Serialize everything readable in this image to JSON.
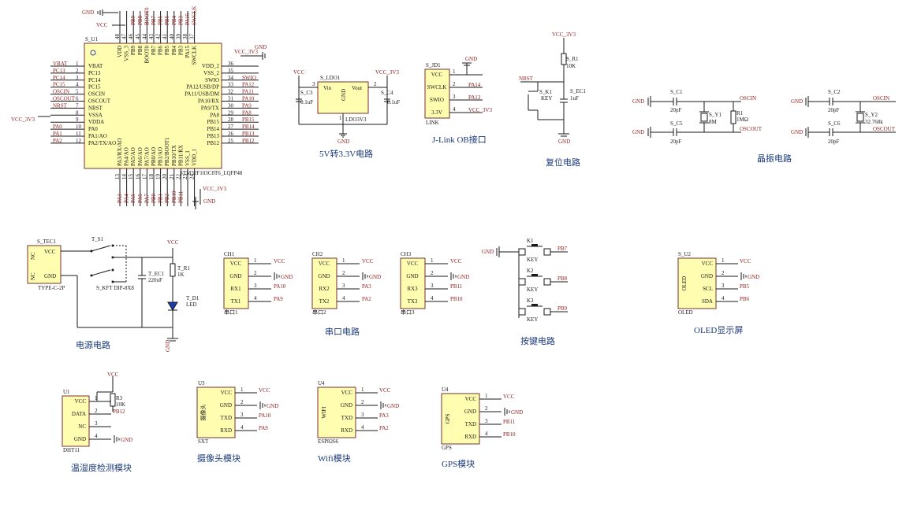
{
  "colors": {
    "part_fill": "#fffdb0",
    "part_border": "#7a3030",
    "wire": "#1a1a1a",
    "net": "#8b1a1a",
    "title": "#1a3a7a"
  },
  "mcu": {
    "ref": "S_U1",
    "part": "STM32F103C8T6_LQFP48",
    "left_pins": [
      {
        "n": "1",
        "name": "VBAT",
        "net": "VBAT"
      },
      {
        "n": "2",
        "name": "PC13",
        "net": "PC13"
      },
      {
        "n": "3",
        "name": "PC14",
        "net": "PC14"
      },
      {
        "n": "4",
        "name": "PC15",
        "net": "PC15"
      },
      {
        "n": "5",
        "name": "OSCIN",
        "net": "OSCIN"
      },
      {
        "n": "6",
        "name": "OSCOUT",
        "net": "OSCOUT"
      },
      {
        "n": "7",
        "name": "NRST",
        "net": "NRST"
      },
      {
        "n": "8",
        "name": "VSSA",
        "net": ""
      },
      {
        "n": "9",
        "name": "VDDA",
        "net": ""
      },
      {
        "n": "10",
        "name": "PA0",
        "net": "PA0"
      },
      {
        "n": "11",
        "name": "PA1/AO",
        "net": "PA1"
      },
      {
        "n": "12",
        "name": "PA2/TX/AO",
        "net": "PA2"
      }
    ],
    "right_pins": [
      {
        "n": "36",
        "name": "VDD_2",
        "net": ""
      },
      {
        "n": "35",
        "name": "VSS_2",
        "net": ""
      },
      {
        "n": "34",
        "name": "SWIO",
        "net": "SWIO"
      },
      {
        "n": "33",
        "name": "PA12/USB/DP",
        "net": "PA12"
      },
      {
        "n": "32",
        "name": "PA11/USB/DM",
        "net": "PA11"
      },
      {
        "n": "31",
        "name": "PA10/RX",
        "net": "PA10"
      },
      {
        "n": "30",
        "name": "PA9/TX",
        "net": "PA9"
      },
      {
        "n": "29",
        "name": "PA8",
        "net": "PA8"
      },
      {
        "n": "28",
        "name": "PB15",
        "net": "PB15"
      },
      {
        "n": "27",
        "name": "PB14",
        "net": "PB14"
      },
      {
        "n": "26",
        "name": "PB13",
        "net": "PB13"
      },
      {
        "n": "25",
        "name": "PB12",
        "net": "PB12"
      }
    ],
    "top_pins": [
      "VDD",
      "VSS_3",
      "PB9",
      "PB8",
      "BOOT0",
      "PB7",
      "PB6",
      "PB5",
      "PB4",
      "PB3",
      "PA15",
      "SWCLK"
    ],
    "top_nums": [
      "48",
      "47",
      "46",
      "45",
      "44",
      "43",
      "42",
      "41",
      "40",
      "39",
      "38",
      "37"
    ],
    "top_nets": [
      "",
      "",
      "PB9",
      "PB8",
      "BOOT0",
      "PB7",
      "PB6",
      "PB5",
      "PB4",
      "PB3",
      "PA15",
      "SWCLK"
    ],
    "bottom_pins": [
      "PA3/RX/AO",
      "PA4/AO",
      "PA5/AO",
      "PA6/AO",
      "PA7/AO",
      "PB0/AO",
      "PB1/AO",
      "PB2/BOOT1",
      "PB10/TX",
      "PB11/RX",
      "VSS_1",
      "VDD_1"
    ],
    "bottom_nums": [
      "13",
      "14",
      "15",
      "16",
      "17",
      "18",
      "19",
      "20",
      "21",
      "22",
      "23",
      "24"
    ],
    "bottom_nets": [
      "PA3",
      "PA4",
      "PA5",
      "PA6",
      "PA7",
      "PB0",
      "PB1",
      "PB2",
      "PB10",
      "PB11",
      "",
      ""
    ],
    "gnd": "GND",
    "vcc": "VCC",
    "vcc3v3": "VCC_3V3"
  },
  "ldo": {
    "ref": "S_LDO1",
    "part": "LDO3V3",
    "vin": "Vin",
    "vout": "Vout",
    "gnd": "GND",
    "c3": "S_C3",
    "c4": "S_C4",
    "cap": "0.1uF",
    "title": "5V转3.3V电路",
    "vcc": "VCC",
    "vcc3v3": "VCC_3V3",
    "gndnet": "GND",
    "p3": "3",
    "p2": "2",
    "p1": "1"
  },
  "jlink": {
    "ref": "S_JD1",
    "part": "LINK",
    "pins": [
      {
        "n": "1",
        "name": "VCC",
        "net": ""
      },
      {
        "n": "2",
        "name": "SWCLK",
        "net": "PA14"
      },
      {
        "n": "3",
        "name": "SWIO",
        "net": "PA13"
      },
      {
        "n": "4",
        "name": "3.3V",
        "net": "VCC_3V3"
      }
    ],
    "gnd": "GND",
    "title": "J-Link OB接口"
  },
  "reset": {
    "vcc": "VCC_3V3",
    "r": "S_R1",
    "rval": "10K",
    "nrst": "NRST",
    "key": "S_K1",
    "keyval": "KEY",
    "cap": "S_EC1",
    "capval": "1uF",
    "gnd": "GND",
    "title": "复位电路"
  },
  "crystal": {
    "c1": "S_C1",
    "c5": "S_C5",
    "c2": "S_C2",
    "c6": "S_C6",
    "cval": "20pF",
    "y1": "S_Y1",
    "y1val": "8M",
    "r": "R1",
    "rval": "1MΩ",
    "y2": "S_Y2",
    "y2val": "32.768k",
    "oscin": "OSCIN",
    "oscout": "OSCOUT",
    "gnd": "GND",
    "title": "晶振电路"
  },
  "power": {
    "conn": "S_TEC1",
    "connpart": "TYPE-C-2P",
    "vcc": "VCC",
    "nc": "NC",
    "gnd": "GND",
    "sw": "T_S1",
    "swpart": "S_KFT DIP-8X8",
    "cap": "T_EC1",
    "capval": "220uF",
    "r": "T_R1",
    "rval": "1K",
    "led": "T_D1",
    "ledval": "LED",
    "title": "电源电路",
    "vccnet": "VCC",
    "gndnet": "GND"
  },
  "uarts": {
    "title": "串口电路",
    "items": [
      {
        "ref": "CH1",
        "name": "串口1",
        "rx": "PA10",
        "tx": "PA9"
      },
      {
        "ref": "CH2",
        "name": "串口2",
        "rx": "PA3",
        "tx": "PA2"
      },
      {
        "ref": "CH3",
        "name": "串口3",
        "rx": "PB11",
        "tx": "PB10"
      }
    ],
    "pins": [
      "VCC",
      "GND",
      "RX1",
      "TX1"
    ],
    "pins2": [
      "VCC",
      "GND",
      "RX2",
      "TX2"
    ],
    "pins3": [
      "VCC",
      "GND",
      "RX3",
      "TX3"
    ],
    "vcc": "VCC",
    "gnd": "GND"
  },
  "keys": {
    "title": "按键电路",
    "gnd": "GND",
    "items": [
      {
        "ref": "K1",
        "net": "PB7",
        "val": "KEY"
      },
      {
        "ref": "K2",
        "net": "PB8",
        "val": "KEY"
      },
      {
        "ref": "K3",
        "net": "PB9",
        "val": "KEY"
      }
    ]
  },
  "oled": {
    "ref": "S_U2",
    "name": "OLED",
    "part": "OLED",
    "pins": [
      "VCC",
      "GND",
      "SCL",
      "SDA"
    ],
    "nets": [
      "VCC",
      "GND",
      "PB5",
      "PB6"
    ],
    "title": "OLED显示屏"
  },
  "dht": {
    "ref": "U1",
    "part": "DHT11",
    "pins": [
      "VCC",
      "DATA",
      "NC",
      "GND"
    ],
    "r": "R3",
    "rval": "10K",
    "vcc": "VCC",
    "data": "PB12",
    "gnd": "GND",
    "title": "温湿度检测模块"
  },
  "cam": {
    "ref": "U3",
    "name": "摄像头",
    "part": "SXT",
    "pins": [
      "VCC",
      "GND",
      "TXD",
      "RXD"
    ],
    "nets": [
      "VCC",
      "GND",
      "PA10",
      "PA9"
    ],
    "title": "摄像头模块"
  },
  "wifi": {
    "ref": "U4",
    "name": "WIFI",
    "part": "ESP8266",
    "pins": [
      "VCC",
      "GND",
      "TXD",
      "RXD"
    ],
    "nets": [
      "VCC",
      "GND",
      "PA3",
      "PA2"
    ],
    "title": "Wifi模块"
  },
  "gps": {
    "ref": "U4",
    "name": "GPS",
    "part": "GPS",
    "pins": [
      "VCC",
      "GND",
      "TXD",
      "RXD"
    ],
    "nets": [
      "VCC",
      "GND",
      "PB11",
      "PB10"
    ],
    "title": "GPS模块"
  }
}
